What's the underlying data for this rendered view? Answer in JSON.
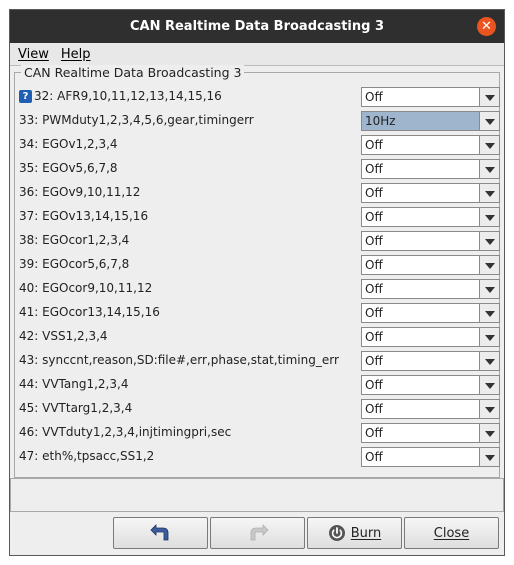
{
  "window": {
    "title": "CAN Realtime Data Broadcasting 3"
  },
  "menu": {
    "view": "View",
    "help": "Help"
  },
  "group": {
    "title": "CAN Realtime Data Broadcasting 3"
  },
  "rows": [
    {
      "label": "32: AFR9,10,11,12,13,14,15,16",
      "value": "Off"
    },
    {
      "label": "33: PWMduty1,2,3,4,5,6,gear,timingerr",
      "value": "10Hz"
    },
    {
      "label": "34: EGOv1,2,3,4",
      "value": "Off"
    },
    {
      "label": "35: EGOv5,6,7,8",
      "value": "Off"
    },
    {
      "label": "36: EGOv9,10,11,12",
      "value": "Off"
    },
    {
      "label": "37: EGOv13,14,15,16",
      "value": "Off"
    },
    {
      "label": "38: EGOcor1,2,3,4",
      "value": "Off"
    },
    {
      "label": "39: EGOcor5,6,7,8",
      "value": "Off"
    },
    {
      "label": "40: EGOcor9,10,11,12",
      "value": "Off"
    },
    {
      "label": "41: EGOcor13,14,15,16",
      "value": "Off"
    },
    {
      "label": "42: VSS1,2,3,4",
      "value": "Off"
    },
    {
      "label": "43: synccnt,reason,SD:file#,err,phase,stat,timing_err",
      "value": "Off"
    },
    {
      "label": "44: VVTang1,2,3,4",
      "value": "Off"
    },
    {
      "label": "45: VVTtarg1,2,3,4",
      "value": "Off"
    },
    {
      "label": "46: VVTduty1,2,3,4,injtimingpri,sec",
      "value": "Off"
    },
    {
      "label": "47: eth%,tpsacc,SS1,2",
      "value": "Off"
    }
  ],
  "buttons": {
    "burn": "Burn",
    "close": "Close"
  },
  "icons": {
    "help": "help-icon",
    "undo": "undo-arrow-icon",
    "redo": "redo-arrow-icon",
    "burn": "power-icon",
    "close_window": "close-icon"
  },
  "colors": {
    "titlebar": "#2f2f2f",
    "close": "#e95420",
    "highlight": "#9fb5ce"
  }
}
